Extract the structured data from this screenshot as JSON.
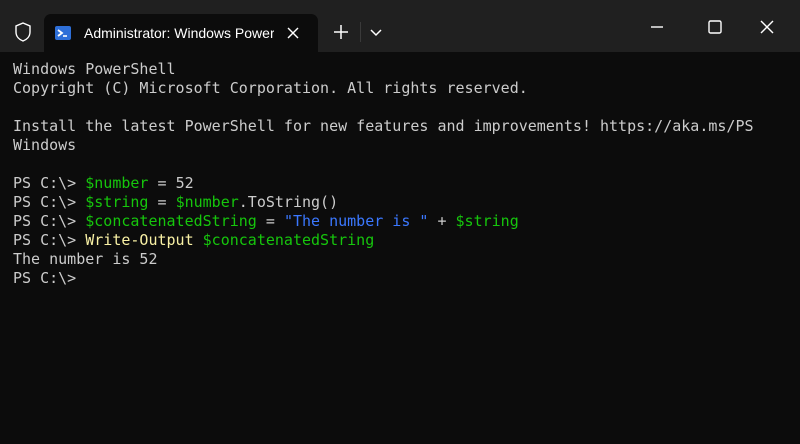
{
  "window": {
    "tab_title": "Administrator: Windows PowerShell",
    "icons": {
      "shield": "shield-icon",
      "tab": "powershell-icon",
      "close_tab": "close-icon",
      "new_tab": "plus-icon",
      "dropdown": "chevron-down-icon",
      "minimize": "minimize-icon",
      "maximize": "maximize-icon",
      "close": "close-icon"
    }
  },
  "terminal": {
    "header_line1": "Windows PowerShell",
    "header_line2": "Copyright (C) Microsoft Corporation. All rights reserved.",
    "install_line1": "Install the latest PowerShell for new features and improvements! https://aka.ms/PS",
    "install_line2": "Windows",
    "prompt": "PS C:\\>",
    "line1": {
      "var": "$number",
      "op": " = ",
      "value": "52"
    },
    "line2": {
      "var": "$string",
      "op": " = ",
      "source": "$number",
      "method": ".ToString()"
    },
    "line3": {
      "var": "$concatenatedString",
      "op": " = ",
      "string": "\"The number is \"",
      "plus": " + ",
      "var2": "$string"
    },
    "line4": {
      "cmdlet": "Write-Output",
      "arg": "$concatenatedString"
    },
    "output": "The number is 52"
  },
  "colors": {
    "background": "#0c0c0c",
    "titlebar": "#202020",
    "text": "#cccccc",
    "variable": "#16c60c",
    "command": "#f9f1a5",
    "string": "#3b78ff"
  }
}
